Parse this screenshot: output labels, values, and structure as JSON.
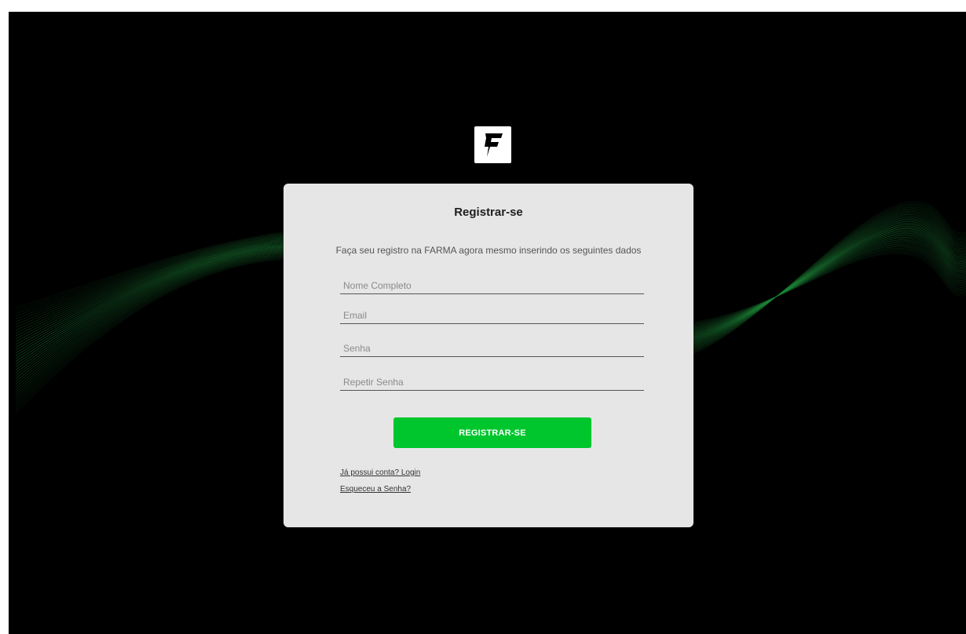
{
  "brand": {
    "logo_letter": "F",
    "logo_icon": "farma-f-logo-icon"
  },
  "colors": {
    "background": "#000000",
    "card": "#e6e6e6",
    "accent": "#00c62e",
    "wave": "#1f8a3a"
  },
  "form": {
    "title": "Registrar-se",
    "subtitle": "Faça seu registro na FARMA agora mesmo inserindo os seguintes dados",
    "fields": {
      "full_name": {
        "placeholder": "Nome Completo",
        "value": ""
      },
      "email": {
        "placeholder": "Email",
        "value": ""
      },
      "password": {
        "placeholder": "Senha",
        "value": ""
      },
      "repeat_password": {
        "placeholder": "Repetir Senha",
        "value": ""
      }
    },
    "submit_label": "REGISTRAR-SE",
    "links": {
      "login": "Já possui conta? Login",
      "forgot": "Esqueceu a Senha?"
    }
  }
}
